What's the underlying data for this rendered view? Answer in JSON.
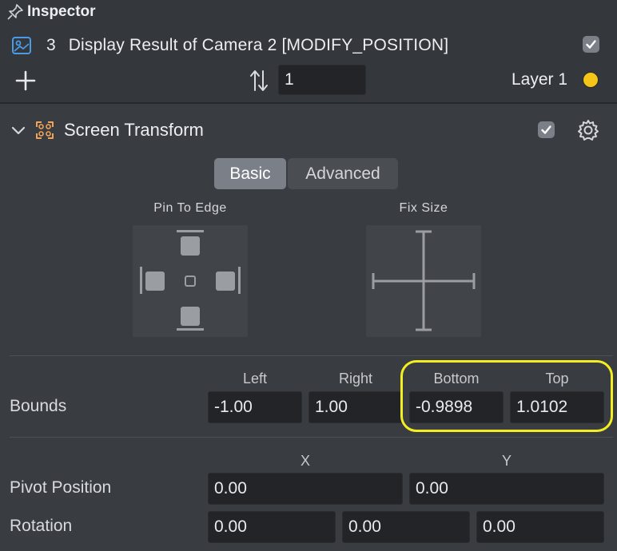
{
  "inspector": {
    "title": "Inspector",
    "object_index": "3",
    "object_name": "Display Result of Camera 2 [MODIFY_POSITION]",
    "object_enabled": true,
    "render_order_value": "1",
    "layer_label": "Layer 1",
    "layer_color": "#f5c518"
  },
  "component": {
    "title": "Screen Transform",
    "enabled": true,
    "tabs": [
      "Basic",
      "Advanced"
    ],
    "active_tab": "Basic",
    "pin_to_edge_label": "Pin To Edge",
    "fix_size_label": "Fix Size"
  },
  "bounds": {
    "label": "Bounds",
    "headers": [
      "Left",
      "Right",
      "Bottom",
      "Top"
    ],
    "values": [
      "-1.00",
      "1.00",
      "-0.9898",
      "1.0102"
    ]
  },
  "pivot": {
    "label": "Pivot Position",
    "headers": [
      "X",
      "Y"
    ],
    "values": [
      "0.00",
      "0.00"
    ]
  },
  "rotation": {
    "label": "Rotation",
    "values": [
      "0.00",
      "0.00",
      "0.00"
    ]
  },
  "icons": {
    "pin": "pin-icon",
    "object": "screen-image-icon",
    "add": "plus-icon",
    "sort": "sort-arrows-icon",
    "collapse": "chevron-down-icon",
    "component": "screen-transform-icon",
    "settings": "gear-icon"
  },
  "colors": {
    "accent_blue": "#4a9be6",
    "component_orange": "#f0a35a",
    "highlight_yellow": "#f2ee22"
  }
}
